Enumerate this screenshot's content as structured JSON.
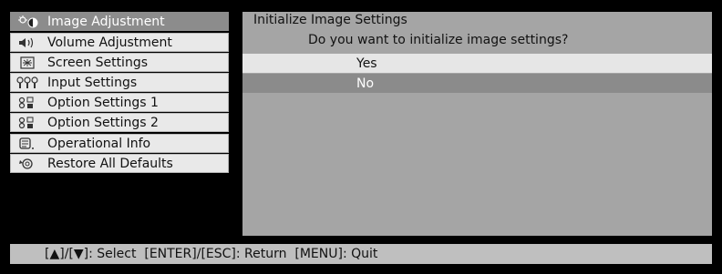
{
  "menu": {
    "items": [
      {
        "label": "Image Adjustment",
        "icon": "image-adjustment-icon",
        "selected": true
      },
      {
        "label": "Volume Adjustment",
        "icon": "speaker-icon",
        "selected": false
      },
      {
        "label": "Screen Settings",
        "icon": "screen-settings-icon",
        "selected": false
      },
      {
        "label": "Input Settings",
        "icon": "input-settings-icon",
        "selected": false
      },
      {
        "label": "Option Settings 1",
        "icon": "option-settings-icon",
        "selected": false
      },
      {
        "label": "Option Settings 2",
        "icon": "option-settings-icon",
        "selected": false
      },
      {
        "label": "Operational Info",
        "icon": "info-list-icon",
        "selected": false
      },
      {
        "label": "Restore All Defaults",
        "icon": "restore-icon",
        "selected": false
      }
    ]
  },
  "panel": {
    "title": "Initialize Image Settings",
    "question": "Do you want to initialize image settings?",
    "options": [
      {
        "label": "Yes",
        "selected": false
      },
      {
        "label": "No",
        "selected": true
      }
    ]
  },
  "footer": {
    "hint": "[▲]/[▼]: Select  [ENTER]/[ESC]: Return  [MENU]: Quit"
  },
  "colors": {
    "background": "#000000",
    "menu_item": "#e9e9e9",
    "menu_selected": "#8c8c8c",
    "panel": "#a5a5a5",
    "option_highlight": "#8b8b8b",
    "footer": "#bfbfbf"
  }
}
